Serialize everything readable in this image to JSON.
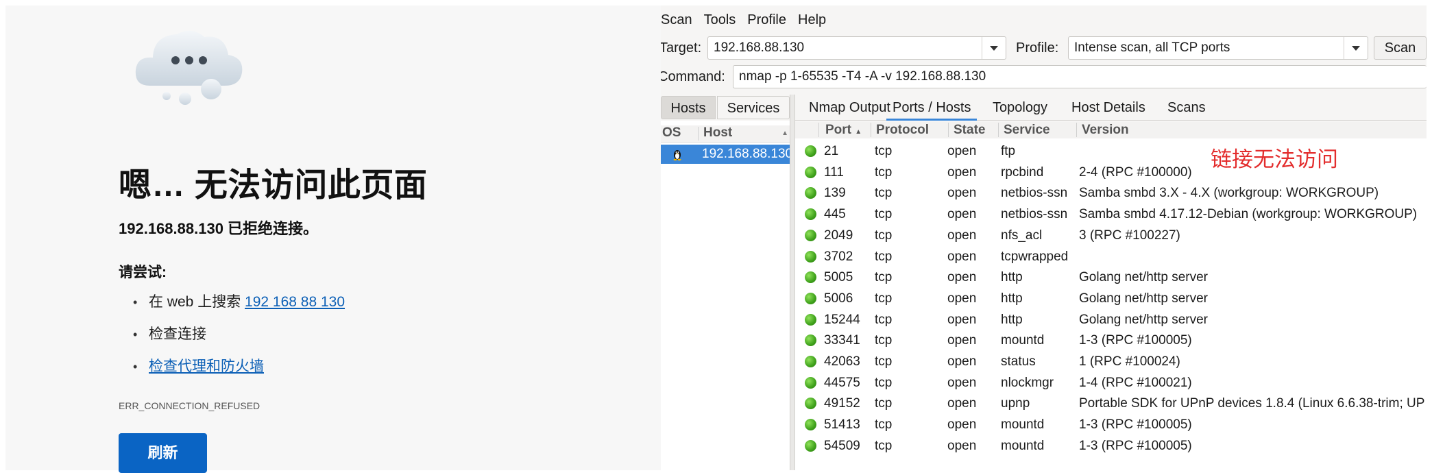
{
  "browser_error": {
    "title": "嗯… 无法访问此页面",
    "subtitle": "192.168.88.130 已拒绝连接。",
    "try_heading": "请尝试:",
    "suggestions": [
      {
        "prefix": "在 web 上搜索 ",
        "link": "192 168 88 130"
      },
      {
        "text": "检查连接"
      },
      {
        "link": "检查代理和防火墙"
      }
    ],
    "error_code": "ERR_CONNECTION_REFUSED",
    "refresh_label": "刷新"
  },
  "zenmap": {
    "menu": [
      "Scan",
      "Tools",
      "Profile",
      "Help"
    ],
    "target_label": "Target:",
    "target_value": "192.168.88.130",
    "profile_label": "Profile:",
    "profile_value": "Intense scan, all TCP ports",
    "scan_button": "Scan",
    "command_label": "Command:",
    "command_value": "nmap -p 1-65535 -T4 -A -v 192.168.88.130",
    "host_tabs": [
      "Hosts",
      "Services"
    ],
    "host_columns": [
      "OS",
      "Host"
    ],
    "hosts": [
      "192.168.88.130"
    ],
    "main_tabs": [
      "Nmap Output",
      "Ports / Hosts",
      "Topology",
      "Host Details",
      "Scans"
    ],
    "active_tab": "Ports / Hosts",
    "port_columns": [
      "Port",
      "Protocol",
      "State",
      "Service",
      "Version"
    ],
    "ports": [
      {
        "port": "21",
        "protocol": "tcp",
        "state": "open",
        "service": "ftp",
        "version": ""
      },
      {
        "port": "111",
        "protocol": "tcp",
        "state": "open",
        "service": "rpcbind",
        "version": "2-4 (RPC #100000)"
      },
      {
        "port": "139",
        "protocol": "tcp",
        "state": "open",
        "service": "netbios-ssn",
        "version": "Samba smbd 3.X - 4.X (workgroup: WORKGROUP)"
      },
      {
        "port": "445",
        "protocol": "tcp",
        "state": "open",
        "service": "netbios-ssn",
        "version": "Samba smbd 4.17.12-Debian (workgroup: WORKGROUP)"
      },
      {
        "port": "2049",
        "protocol": "tcp",
        "state": "open",
        "service": "nfs_acl",
        "version": "3 (RPC #100227)"
      },
      {
        "port": "3702",
        "protocol": "tcp",
        "state": "open",
        "service": "tcpwrapped",
        "version": ""
      },
      {
        "port": "5005",
        "protocol": "tcp",
        "state": "open",
        "service": "http",
        "version": "Golang net/http server"
      },
      {
        "port": "5006",
        "protocol": "tcp",
        "state": "open",
        "service": "http",
        "version": "Golang net/http server"
      },
      {
        "port": "15244",
        "protocol": "tcp",
        "state": "open",
        "service": "http",
        "version": "Golang net/http server"
      },
      {
        "port": "33341",
        "protocol": "tcp",
        "state": "open",
        "service": "mountd",
        "version": "1-3 (RPC #100005)"
      },
      {
        "port": "42063",
        "protocol": "tcp",
        "state": "open",
        "service": "status",
        "version": "1 (RPC #100024)"
      },
      {
        "port": "44575",
        "protocol": "tcp",
        "state": "open",
        "service": "nlockmgr",
        "version": "1-4 (RPC #100021)"
      },
      {
        "port": "49152",
        "protocol": "tcp",
        "state": "open",
        "service": "upnp",
        "version": "Portable SDK for UPnP devices 1.8.4 (Linux 6.6.38-trim; UP"
      },
      {
        "port": "51413",
        "protocol": "tcp",
        "state": "open",
        "service": "mountd",
        "version": "1-3 (RPC #100005)"
      },
      {
        "port": "54509",
        "protocol": "tcp",
        "state": "open",
        "service": "mountd",
        "version": "1-3 (RPC #100005)"
      }
    ],
    "annotation": "链接无法访问",
    "status_color": "#3fa11b",
    "annotation_color": "#e32d2d"
  }
}
